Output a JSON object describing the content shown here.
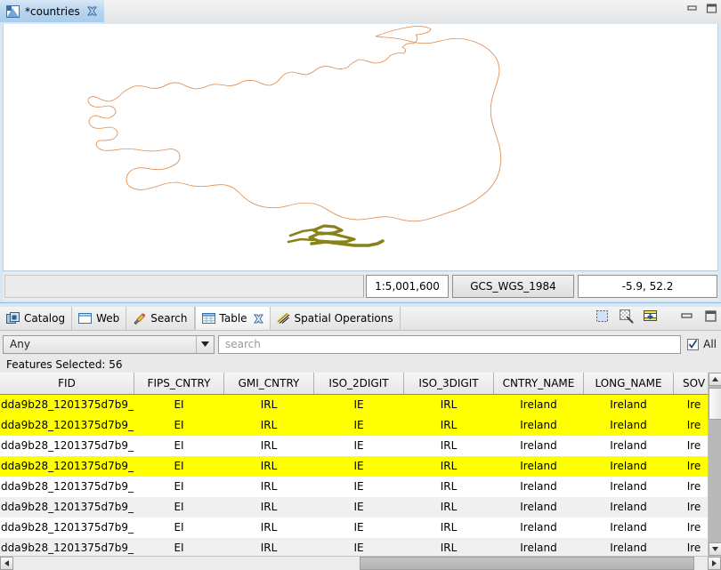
{
  "window": {
    "minimize_label": "Minimize",
    "maximize_label": "Maximize"
  },
  "editor": {
    "tab": {
      "label": "*countries",
      "icon": "map-layer-icon",
      "close_icon": "close-icon"
    },
    "status": {
      "scale": "1:5,001,600",
      "crs": "GCS_WGS_1984",
      "coords": "-5.9, 52.2"
    },
    "map": {
      "outline_color": "#e08a4e",
      "selection_color": "#8a8219",
      "background": "#ffffff"
    }
  },
  "view_stack": {
    "tabs": [
      {
        "label": "Catalog",
        "icon": "catalog-icon",
        "selected": false,
        "closable": false
      },
      {
        "label": "Web",
        "icon": "web-icon",
        "selected": false,
        "closable": false
      },
      {
        "label": "Search",
        "icon": "search-icon",
        "selected": false,
        "closable": false
      },
      {
        "label": "Table",
        "icon": "table-icon",
        "selected": true,
        "closable": true
      },
      {
        "label": "Spatial Operations",
        "icon": "spatial-operations-icon",
        "selected": false,
        "closable": false
      }
    ],
    "toolbar": [
      {
        "name": "select-features-icon",
        "title": "Select features"
      },
      {
        "name": "zoom-to-selection-icon",
        "title": "Zoom to selection"
      },
      {
        "name": "add-row-icon",
        "title": "Add row"
      }
    ]
  },
  "filter": {
    "field_selector": "Any",
    "field_options": [
      "Any"
    ],
    "search_placeholder": "search",
    "search_value": "",
    "all_label": "All",
    "all_checked": true
  },
  "table": {
    "status": "Features Selected: 56",
    "columns": [
      {
        "key": "fid",
        "label": "FID",
        "width": 150
      },
      {
        "key": "fips_cntry",
        "label": "FIPS_CNTRY",
        "width": 100
      },
      {
        "key": "gmi_cntry",
        "label": "GMI_CNTRY",
        "width": 100
      },
      {
        "key": "iso_2digit",
        "label": "ISO_2DIGIT",
        "width": 100
      },
      {
        "key": "iso_3digit",
        "label": "ISO_3DIGIT",
        "width": 100
      },
      {
        "key": "cntry_name",
        "label": "CNTRY_NAME",
        "width": 100
      },
      {
        "key": "long_name",
        "label": "LONG_NAME",
        "width": 100
      },
      {
        "key": "sov",
        "label": "SOV",
        "width": 45
      }
    ],
    "rows": [
      {
        "state": "yellow",
        "fid": "dda9b28_1201375d7b9_",
        "fips_cntry": "EI",
        "gmi_cntry": "IRL",
        "iso_2digit": "IE",
        "iso_3digit": "IRL",
        "cntry_name": "Ireland",
        "long_name": "Ireland",
        "sov": "Ire"
      },
      {
        "state": "yellow",
        "fid": "dda9b28_1201375d7b9_",
        "fips_cntry": "EI",
        "gmi_cntry": "IRL",
        "iso_2digit": "IE",
        "iso_3digit": "IRL",
        "cntry_name": "Ireland",
        "long_name": "Ireland",
        "sov": "Ire"
      },
      {
        "state": "white",
        "fid": "dda9b28_1201375d7b9_",
        "fips_cntry": "EI",
        "gmi_cntry": "IRL",
        "iso_2digit": "IE",
        "iso_3digit": "IRL",
        "cntry_name": "Ireland",
        "long_name": "Ireland",
        "sov": "Ire"
      },
      {
        "state": "yellow",
        "fid": "dda9b28_1201375d7b9_",
        "fips_cntry": "EI",
        "gmi_cntry": "IRL",
        "iso_2digit": "IE",
        "iso_3digit": "IRL",
        "cntry_name": "Ireland",
        "long_name": "Ireland",
        "sov": "Ire"
      },
      {
        "state": "white",
        "fid": "dda9b28_1201375d7b9_",
        "fips_cntry": "EI",
        "gmi_cntry": "IRL",
        "iso_2digit": "IE",
        "iso_3digit": "IRL",
        "cntry_name": "Ireland",
        "long_name": "Ireland",
        "sov": "Ire"
      },
      {
        "state": "grey",
        "fid": "dda9b28_1201375d7b9_",
        "fips_cntry": "EI",
        "gmi_cntry": "IRL",
        "iso_2digit": "IE",
        "iso_3digit": "IRL",
        "cntry_name": "Ireland",
        "long_name": "Ireland",
        "sov": "Ire"
      },
      {
        "state": "white",
        "fid": "dda9b28_1201375d7b9_",
        "fips_cntry": "EI",
        "gmi_cntry": "IRL",
        "iso_2digit": "IE",
        "iso_3digit": "IRL",
        "cntry_name": "Ireland",
        "long_name": "Ireland",
        "sov": "Ire"
      },
      {
        "state": "grey",
        "fid": "dda9b28_1201375d7b9_",
        "fips_cntry": "EI",
        "gmi_cntry": "IRL",
        "iso_2digit": "IE",
        "iso_3digit": "IRL",
        "cntry_name": "Ireland",
        "long_name": "Ireland",
        "sov": "Ire"
      }
    ]
  }
}
